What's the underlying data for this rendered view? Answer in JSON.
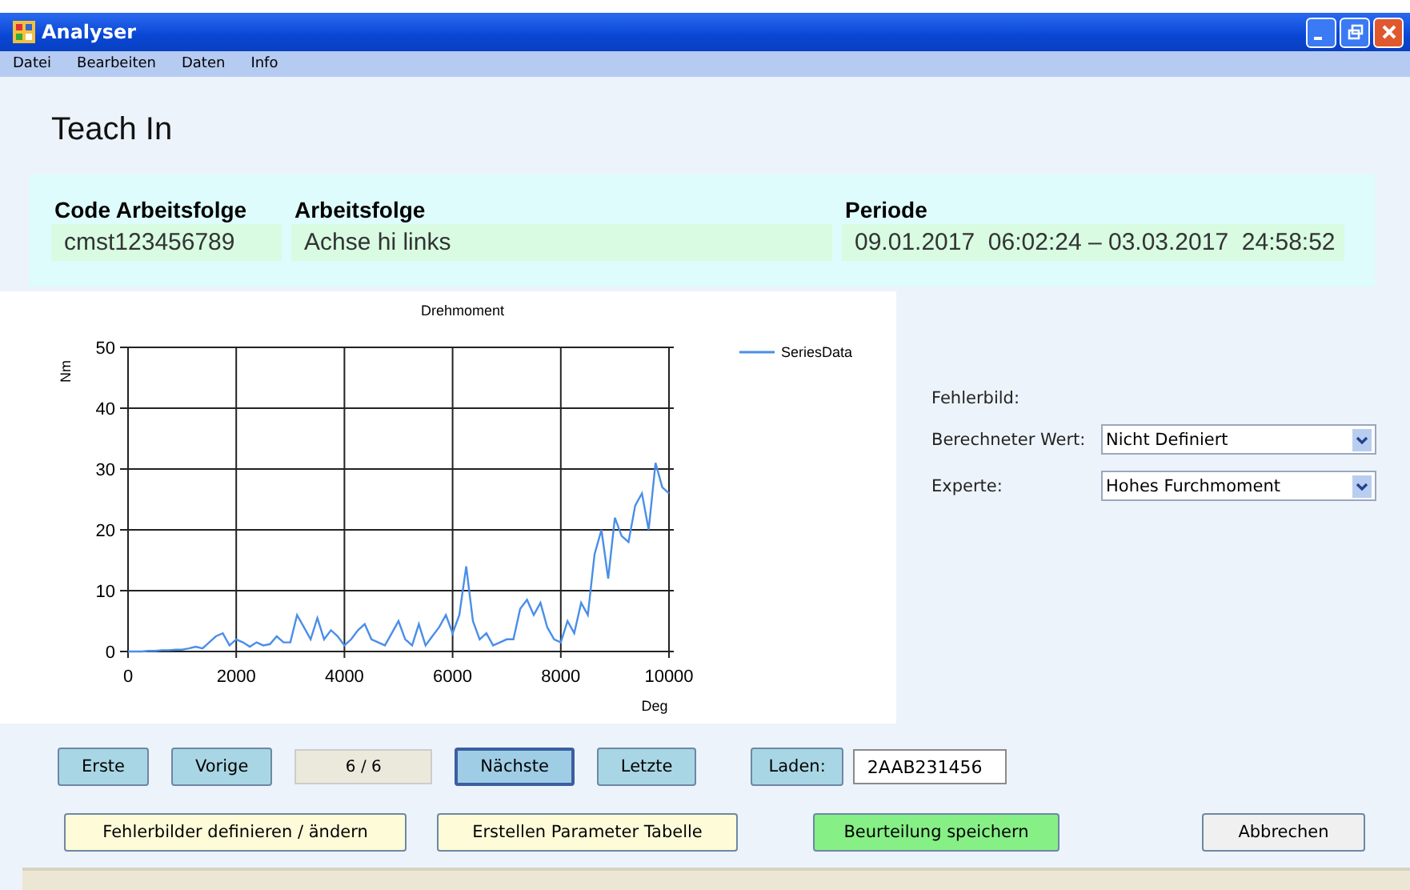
{
  "window": {
    "title": "Analyser"
  },
  "menu": [
    "Datei",
    "Bearbeiten",
    "Daten",
    "Info"
  ],
  "heading": "Teach In",
  "info": [
    {
      "label": "Code Arbeitsfolge",
      "value": "cmst123456789"
    },
    {
      "label": "Arbeitsfolge",
      "value": "Achse hi links"
    },
    {
      "label": "Periode",
      "value": "09.01.2017  06:02:24 – 03.03.2017  24:58:52"
    }
  ],
  "chart": {
    "chart_data": {
      "type": "line",
      "grid": true,
      "title": "Drehmoment",
      "xlabel": "Deg",
      "ylabel": "Nm",
      "xlim": [
        0,
        10000
      ],
      "ylim": [
        0,
        50
      ],
      "xticks": [
        0,
        2000,
        4000,
        6000,
        8000,
        10000
      ],
      "yticks": [
        0,
        10,
        20,
        30,
        40,
        50
      ],
      "x": [
        0,
        125,
        250,
        375,
        500,
        625,
        750,
        875,
        1000,
        1125,
        1250,
        1375,
        1500,
        1625,
        1750,
        1875,
        2000,
        2125,
        2250,
        2375,
        2500,
        2625,
        2750,
        2875,
        3000,
        3125,
        3250,
        3375,
        3500,
        3625,
        3750,
        3875,
        4000,
        4125,
        4250,
        4375,
        4500,
        4625,
        4750,
        4875,
        5000,
        5125,
        5250,
        5375,
        5500,
        5625,
        5750,
        5875,
        6000,
        6125,
        6250,
        6375,
        6500,
        6625,
        6750,
        6875,
        7000,
        7125,
        7250,
        7375,
        7500,
        7625,
        7750,
        7875,
        8000,
        8125,
        8250,
        8375,
        8500,
        8625,
        8750,
        8875,
        9000,
        9125,
        9250,
        9375,
        9500,
        9625,
        9750,
        9875,
        10000
      ],
      "series": [
        {
          "name": "SeriesData",
          "color": "#4a8ee8",
          "values": [
            0,
            0,
            0,
            0.1,
            0.1,
            0.2,
            0.2,
            0.3,
            0.3,
            0.5,
            0.8,
            0.5,
            1.5,
            2.5,
            3,
            1,
            2,
            1.5,
            0.8,
            1.5,
            1,
            1.2,
            2.5,
            1.5,
            1.5,
            6,
            4,
            2,
            5.5,
            2,
            3.5,
            2.5,
            1,
            2,
            3.5,
            4.5,
            2,
            1.5,
            1,
            3,
            5,
            2,
            1,
            4.5,
            1,
            2.5,
            4,
            6,
            3,
            6,
            14,
            5,
            2,
            3,
            1,
            1.5,
            2,
            2,
            7,
            8.5,
            6,
            8,
            4,
            2,
            1.5,
            5,
            3,
            8,
            6,
            16,
            20,
            12,
            22,
            19,
            18,
            24,
            26,
            20,
            31,
            27,
            26
          ]
        }
      ]
    }
  },
  "fault": {
    "label": "Fehlerbild:",
    "fields": [
      {
        "label": "Berechneter Wert:",
        "value": "Nicht Definiert"
      },
      {
        "label": "Experte:",
        "value": "Hohes Furchmoment"
      }
    ]
  },
  "nav": [
    {
      "kind": "button",
      "label": "Erste",
      "focused": false
    },
    {
      "kind": "button",
      "label": "Vorige",
      "focused": false
    },
    {
      "kind": "counter",
      "label": "6 / 6"
    },
    {
      "kind": "button",
      "label": "Nächste",
      "focused": true
    },
    {
      "kind": "button",
      "label": "Letzte",
      "focused": false
    }
  ],
  "load": {
    "label": "Laden:",
    "value": "2AAB231456"
  },
  "actions": [
    {
      "label": "Fehlerbilder definieren / ändern",
      "color": "#fdfbd8"
    },
    {
      "label": "Erstellen Parameter Tabelle",
      "color": "#fdfbd8"
    },
    {
      "label": "Beurteilung speichern",
      "color": "#86ef86"
    },
    {
      "label": "Abbrechen",
      "color": "#f0f0f0"
    }
  ]
}
